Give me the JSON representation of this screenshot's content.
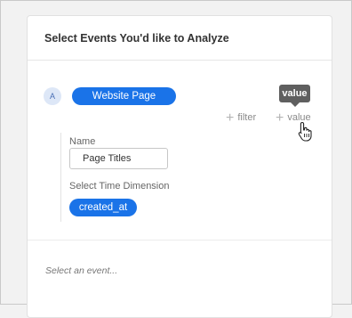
{
  "panel": {
    "title": "Select Events You'd like to Analyze"
  },
  "event": {
    "avatar_letter": "A",
    "name": "Website Page View",
    "actions": {
      "filter_label": "filter",
      "value_label": "value"
    },
    "tooltip": "value",
    "name_field": {
      "label": "Name",
      "value": "Page Titles"
    },
    "time_dimension": {
      "label": "Select Time Dimension",
      "value": "created_at"
    }
  },
  "select_event_placeholder": "Select an event...",
  "colors": {
    "accent": "#1a73e8",
    "tooltip_bg": "#5f5f5f",
    "background": "#f2f2f2"
  }
}
